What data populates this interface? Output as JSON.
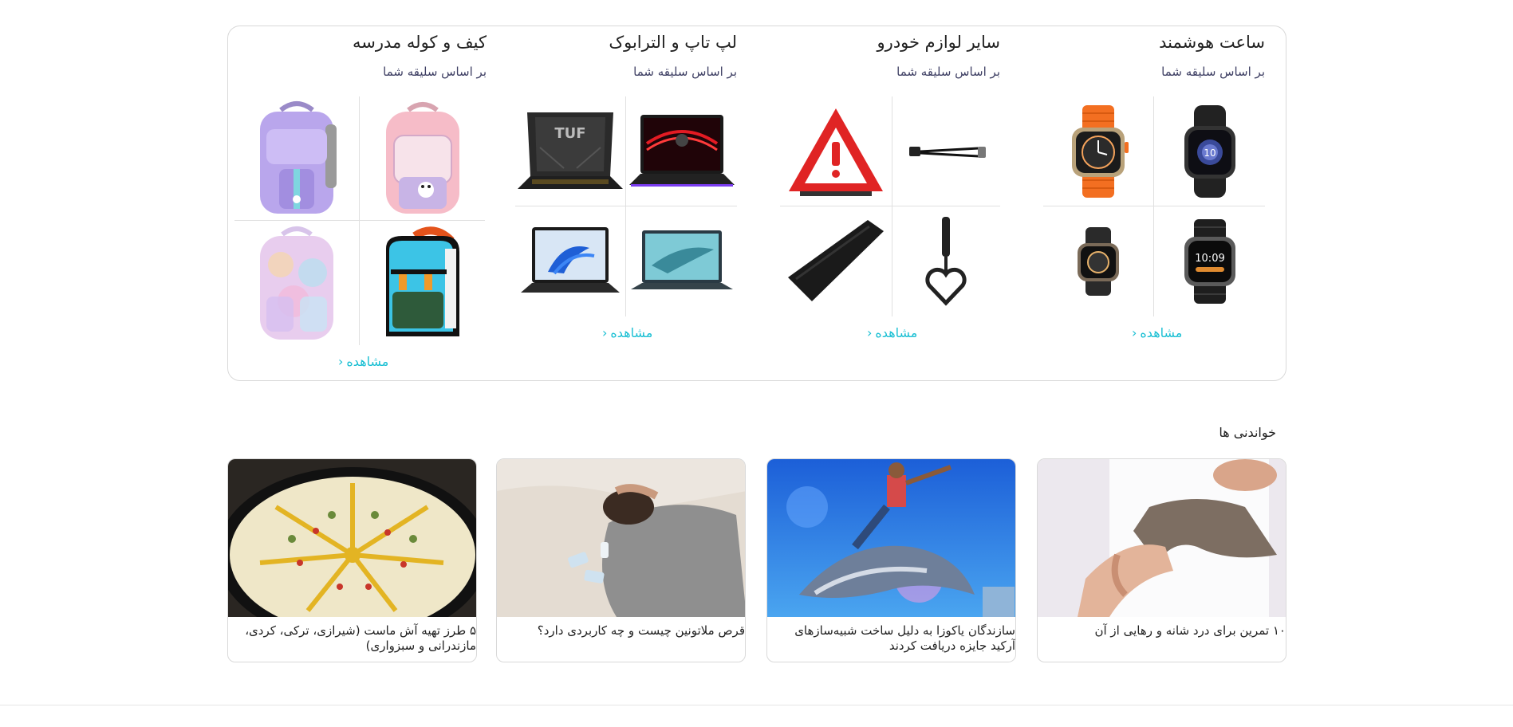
{
  "categories": [
    {
      "title": "ساعت هوشمند",
      "subtitle": "بر اساس سلیقه شما",
      "link": "مشاهده",
      "images": [
        "smartwatch-black-icon",
        "smartwatch-orange-band-icon",
        "smartwatch-ultra-black-icon",
        "smartwatch-small-black-icon"
      ]
    },
    {
      "title": "سایر لوازم خودرو",
      "subtitle": "بر اساس سلیقه شما",
      "link": "مشاهده",
      "images": [
        "car-cable-icon",
        "warning-triangle-icon",
        "car-hook-heart-icon",
        "car-seat-gap-filler-icon"
      ]
    },
    {
      "title": "لپ تاپ و الترابوک",
      "subtitle": "بر اساس سلیقه شما",
      "link": "مشاهده",
      "images": [
        "gaming-laptop-red-icon",
        "laptop-tuf-icon",
        "laptop-zenbook-icon",
        "laptop-windows-icon"
      ]
    },
    {
      "title": "کیف و کوله مدرسه",
      "subtitle": "بر اساس سلیقه شما",
      "link": "مشاهده",
      "images": [
        "backpack-pink-icon",
        "backpack-purple-icon",
        "backpack-cartoon-icon",
        "backpack-pastel-icon"
      ]
    }
  ],
  "reads": {
    "title": "خواندنی ها",
    "articles": [
      {
        "title": "۱۰ تمرین برای درد شانه و رهایی از آن",
        "image": "shoulder-therapy-image"
      },
      {
        "title": "سازندگان یاکوزا به دلیل ساخت شبیه‌سازهای آرکید جایزه دریافت کردند",
        "image": "dolphin-rider-image"
      },
      {
        "title": "قرص ملاتونین چیست و چه کاربردی دارد؟",
        "image": "sleeping-person-image"
      },
      {
        "title": "۵ طرز تهیه آش ماست (شیرازی، ترکی، کردی، مازندرانی و سبزواری)",
        "image": "ash-mast-image"
      }
    ]
  },
  "colors": {
    "accent": "#19bfd3",
    "border": "#d9d9d9",
    "text": "#212121"
  }
}
